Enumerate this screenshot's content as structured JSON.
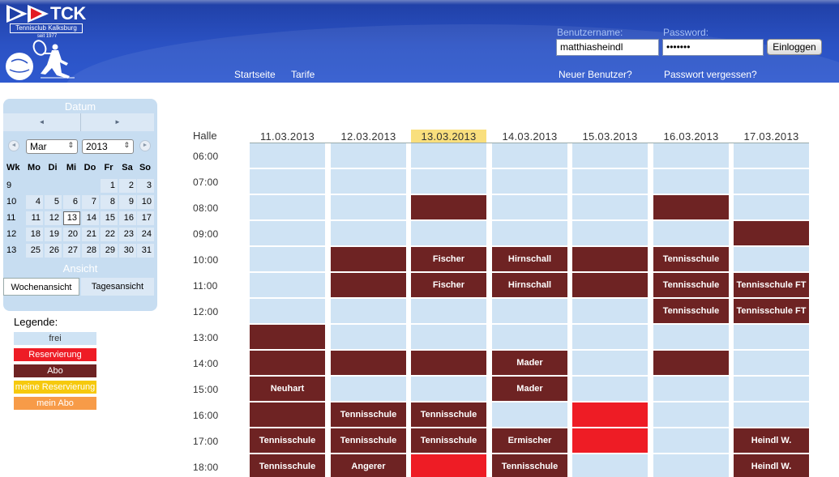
{
  "colors": {
    "header": "#2b52c4",
    "frei": "#cfe3f4",
    "reservierung": "#ee1c25",
    "abo": "#6e2323",
    "meine_reservierung": "#f6c90e",
    "mein_abo": "#f79b48",
    "today_highlight": "#f9df7d",
    "panel": "#c7ddf1"
  },
  "logo": {
    "abbr": "TCK",
    "club_name": "Tennisclub Kalksburg",
    "since": "seit 1977",
    "icon": "tennis-player-icon"
  },
  "login": {
    "username_label": "Benutzername:",
    "username_value": "matthiasheindl",
    "password_label": "Password:",
    "password_value": "•••••••",
    "login_button": "Einloggen",
    "new_user": "Neuer Benutzer?",
    "forgot_password": "Passwort vergessen?"
  },
  "nav": {
    "home": "Startseite",
    "tariffs": "Tarife"
  },
  "sidebar": {
    "date_title": "Datum",
    "prev_arrow": "◄",
    "next_arrow": "►",
    "month": "Mar",
    "year": "2013",
    "weekday_headers": [
      "Wk",
      "Mo",
      "Di",
      "Mi",
      "Do",
      "Fr",
      "Sa",
      "So"
    ],
    "weeks": [
      {
        "wk": "9",
        "days": [
          "",
          "",
          "",
          "",
          "1",
          "2",
          "3"
        ]
      },
      {
        "wk": "10",
        "days": [
          "4",
          "5",
          "6",
          "7",
          "8",
          "9",
          "10"
        ]
      },
      {
        "wk": "11",
        "days": [
          "11",
          "12",
          "13",
          "14",
          "15",
          "16",
          "17"
        ]
      },
      {
        "wk": "12",
        "days": [
          "18",
          "19",
          "20",
          "21",
          "22",
          "23",
          "24"
        ]
      },
      {
        "wk": "13",
        "days": [
          "25",
          "26",
          "27",
          "28",
          "29",
          "30",
          "31"
        ]
      }
    ],
    "today_day": "13",
    "view_title": "Ansicht",
    "week_view": "Wochenansicht",
    "day_view": "Tagesansicht"
  },
  "legend": {
    "title": "Legende:",
    "items": [
      {
        "label": "frei",
        "color": "#cfe3f4",
        "text_color": "#333333"
      },
      {
        "label": "Reservierung",
        "color": "#ee1c25",
        "text_color": "#ffffff"
      },
      {
        "label": "Abo",
        "color": "#6e2323",
        "text_color": "#ffffff"
      },
      {
        "label": "meine Reservierung",
        "color": "#f6c90e",
        "text_color": "#ffffff"
      },
      {
        "label": "mein Abo",
        "color": "#f79b48",
        "text_color": "#ffffff"
      }
    ]
  },
  "schedule": {
    "halle_label": "Halle",
    "today_index": 2,
    "dates": [
      "11.03.2013",
      "12.03.2013",
      "13.03.2013",
      "14.03.2013",
      "15.03.2013",
      "16.03.2013",
      "17.03.2013"
    ],
    "times": [
      "06:00",
      "07:00",
      "08:00",
      "09:00",
      "10:00",
      "11:00",
      "12:00",
      "13:00",
      "14:00",
      "15:00",
      "16:00",
      "17:00",
      "18:00"
    ],
    "slots": [
      [
        {
          "s": "frei",
          "t": ""
        },
        {
          "s": "frei",
          "t": ""
        },
        {
          "s": "frei",
          "t": ""
        },
        {
          "s": "frei",
          "t": ""
        },
        {
          "s": "frei",
          "t": ""
        },
        {
          "s": "frei",
          "t": ""
        },
        {
          "s": "frei",
          "t": ""
        }
      ],
      [
        {
          "s": "frei",
          "t": ""
        },
        {
          "s": "frei",
          "t": ""
        },
        {
          "s": "frei",
          "t": ""
        },
        {
          "s": "frei",
          "t": ""
        },
        {
          "s": "frei",
          "t": ""
        },
        {
          "s": "frei",
          "t": ""
        },
        {
          "s": "frei",
          "t": ""
        }
      ],
      [
        {
          "s": "frei",
          "t": ""
        },
        {
          "s": "frei",
          "t": ""
        },
        {
          "s": "abo",
          "t": ""
        },
        {
          "s": "frei",
          "t": ""
        },
        {
          "s": "frei",
          "t": ""
        },
        {
          "s": "abo",
          "t": ""
        },
        {
          "s": "frei",
          "t": ""
        }
      ],
      [
        {
          "s": "frei",
          "t": ""
        },
        {
          "s": "frei",
          "t": ""
        },
        {
          "s": "frei",
          "t": ""
        },
        {
          "s": "frei",
          "t": ""
        },
        {
          "s": "frei",
          "t": ""
        },
        {
          "s": "frei",
          "t": ""
        },
        {
          "s": "abo",
          "t": ""
        }
      ],
      [
        {
          "s": "frei",
          "t": ""
        },
        {
          "s": "abo",
          "t": ""
        },
        {
          "s": "abo",
          "t": "Fischer"
        },
        {
          "s": "abo",
          "t": "Hirnschall"
        },
        {
          "s": "abo",
          "t": ""
        },
        {
          "s": "abo",
          "t": "Tennisschule"
        },
        {
          "s": "frei",
          "t": ""
        }
      ],
      [
        {
          "s": "frei",
          "t": ""
        },
        {
          "s": "abo",
          "t": ""
        },
        {
          "s": "abo",
          "t": "Fischer"
        },
        {
          "s": "abo",
          "t": "Hirnschall"
        },
        {
          "s": "abo",
          "t": ""
        },
        {
          "s": "abo",
          "t": "Tennisschule"
        },
        {
          "s": "abo",
          "t": "Tennisschule FT"
        }
      ],
      [
        {
          "s": "frei",
          "t": ""
        },
        {
          "s": "frei",
          "t": ""
        },
        {
          "s": "frei",
          "t": ""
        },
        {
          "s": "frei",
          "t": ""
        },
        {
          "s": "frei",
          "t": ""
        },
        {
          "s": "abo",
          "t": "Tennisschule"
        },
        {
          "s": "abo",
          "t": "Tennisschule FT"
        }
      ],
      [
        {
          "s": "abo",
          "t": ""
        },
        {
          "s": "frei",
          "t": ""
        },
        {
          "s": "frei",
          "t": ""
        },
        {
          "s": "frei",
          "t": ""
        },
        {
          "s": "frei",
          "t": ""
        },
        {
          "s": "frei",
          "t": ""
        },
        {
          "s": "frei",
          "t": ""
        }
      ],
      [
        {
          "s": "abo",
          "t": ""
        },
        {
          "s": "abo",
          "t": ""
        },
        {
          "s": "abo",
          "t": ""
        },
        {
          "s": "abo",
          "t": "Mader"
        },
        {
          "s": "frei",
          "t": ""
        },
        {
          "s": "abo",
          "t": ""
        },
        {
          "s": "frei",
          "t": ""
        }
      ],
      [
        {
          "s": "abo",
          "t": "Neuhart"
        },
        {
          "s": "frei",
          "t": ""
        },
        {
          "s": "frei",
          "t": ""
        },
        {
          "s": "abo",
          "t": "Mader"
        },
        {
          "s": "frei",
          "t": ""
        },
        {
          "s": "frei",
          "t": ""
        },
        {
          "s": "frei",
          "t": ""
        }
      ],
      [
        {
          "s": "abo",
          "t": ""
        },
        {
          "s": "abo",
          "t": "Tennisschule"
        },
        {
          "s": "abo",
          "t": "Tennisschule"
        },
        {
          "s": "frei",
          "t": ""
        },
        {
          "s": "res",
          "t": ""
        },
        {
          "s": "frei",
          "t": ""
        },
        {
          "s": "frei",
          "t": ""
        }
      ],
      [
        {
          "s": "abo",
          "t": "Tennisschule"
        },
        {
          "s": "abo",
          "t": "Tennisschule"
        },
        {
          "s": "abo",
          "t": "Tennisschule"
        },
        {
          "s": "abo",
          "t": "Ermischer"
        },
        {
          "s": "res",
          "t": ""
        },
        {
          "s": "frei",
          "t": ""
        },
        {
          "s": "abo",
          "t": "Heindl W."
        }
      ],
      [
        {
          "s": "abo",
          "t": "Tennisschule"
        },
        {
          "s": "abo",
          "t": "Angerer"
        },
        {
          "s": "res",
          "t": ""
        },
        {
          "s": "abo",
          "t": "Tennisschule"
        },
        {
          "s": "frei",
          "t": ""
        },
        {
          "s": "frei",
          "t": ""
        },
        {
          "s": "abo",
          "t": "Heindl W."
        }
      ]
    ]
  }
}
